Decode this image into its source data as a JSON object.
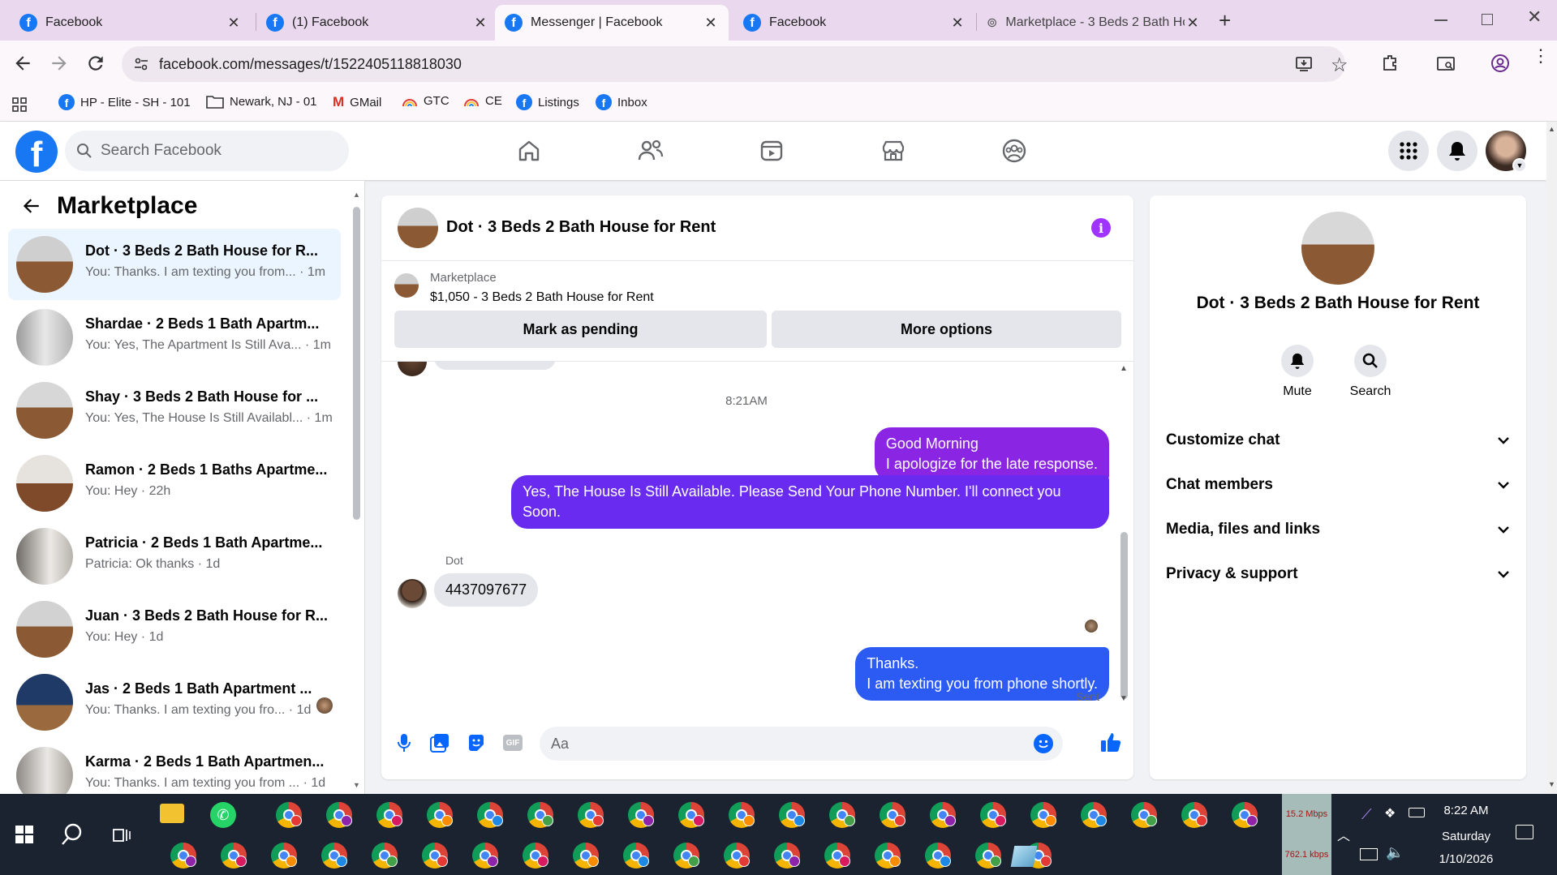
{
  "browser": {
    "tabs": [
      {
        "title": "Facebook",
        "active": false
      },
      {
        "title": "(1) Facebook",
        "active": false
      },
      {
        "title": "Messenger | Facebook",
        "active": true
      },
      {
        "title": "Facebook",
        "active": false
      },
      {
        "title": "Marketplace - 3 Beds 2 Bath Ho",
        "active": false
      }
    ],
    "new_tab": "+",
    "url": "facebook.com/messages/t/1522405118818030",
    "bookmarks": [
      {
        "label": "HP - Elite - SH - 101",
        "icon": "facebook-icon"
      },
      {
        "label": "Newark, NJ - 01",
        "icon": "folder-icon"
      },
      {
        "label": "GMail",
        "icon": "gmail-icon"
      },
      {
        "label": "GTC",
        "icon": "rainbow-icon"
      },
      {
        "label": "CE",
        "icon": "rainbow-icon"
      },
      {
        "label": "Listings",
        "icon": "facebook-icon"
      },
      {
        "label": "Inbox",
        "icon": "facebook-icon"
      }
    ]
  },
  "header": {
    "search_placeholder": "Search Facebook"
  },
  "sidebar": {
    "title": "Marketplace",
    "conversations": [
      {
        "name": "Dot · 3 Beds 2 Bath House for R...",
        "preview": "You: Thanks. I am texting you from... · 1m",
        "active": true
      },
      {
        "name": "Shardae · 2 Beds 1 Bath Apartm...",
        "preview": "You: Yes, The Apartment Is Still Ava... · 1m",
        "active": false
      },
      {
        "name": "Shay · 3 Beds 2 Bath House for ...",
        "preview": "You: Yes, The House Is Still Availabl... · 1m",
        "active": false
      },
      {
        "name": "Ramon · 2 Beds 1 Baths Apartme...",
        "preview": "You: Hey · 22h",
        "active": false
      },
      {
        "name": "Patricia · 2 Beds 1 Bath Apartme...",
        "preview": "Patricia: Ok thanks · 1d",
        "active": false
      },
      {
        "name": "Juan · 3 Beds 2 Bath House for R...",
        "preview": "You: Hey · 1d",
        "active": false
      },
      {
        "name": "Jas · 2 Beds 1 Bath Apartment ...",
        "preview": "You: Thanks. I am texting you fro... · 1d",
        "active": false
      },
      {
        "name": "Karma · 2 Beds 1 Bath Apartmen...",
        "preview": "You: Thanks. I am texting you from ... · 1d",
        "active": false
      }
    ]
  },
  "chat": {
    "title": "Dot · 3 Beds 2 Bath House for Rent",
    "listing_label": "Marketplace",
    "listing_text": "$1,050 - 3 Beds 2 Bath House for Rent",
    "mark_pending": "Mark as pending",
    "more_options": "More options",
    "timestamp": "8:21AM",
    "messages": [
      {
        "from": "me",
        "lines": [
          "Good Morning",
          "I apologize for the late response."
        ],
        "color": "#8a25e3"
      },
      {
        "from": "me",
        "lines": [
          "Yes, The House Is Still Available. Please Send Your Phone Number. I'll connect you",
          "Soon."
        ],
        "color": "#6a2bf0"
      },
      {
        "from": "Dot",
        "sender": "Dot",
        "lines": [
          "4437097677"
        ]
      },
      {
        "from": "me",
        "lines": [
          "Thanks.",
          "I am texting you from phone shortly."
        ],
        "color": "#2c5bf4"
      }
    ],
    "sent_status": "Sent",
    "composer_placeholder": "Aa"
  },
  "details": {
    "name": "Dot · 3 Beds 2 Bath House for Rent",
    "mute": "Mute",
    "search": "Search",
    "sections": [
      "Customize chat",
      "Chat members",
      "Media, files and links",
      "Privacy & support"
    ]
  },
  "taskbar": {
    "upload": "15.2 Mbps",
    "download": "762.1 kbps",
    "time": "8:22 AM",
    "day": "Saturday",
    "date": "1/10/2026"
  },
  "colors": {
    "fb_blue": "#1877f2",
    "accent_purple": "#a033ff",
    "tab_bg": "#ead9ee"
  }
}
